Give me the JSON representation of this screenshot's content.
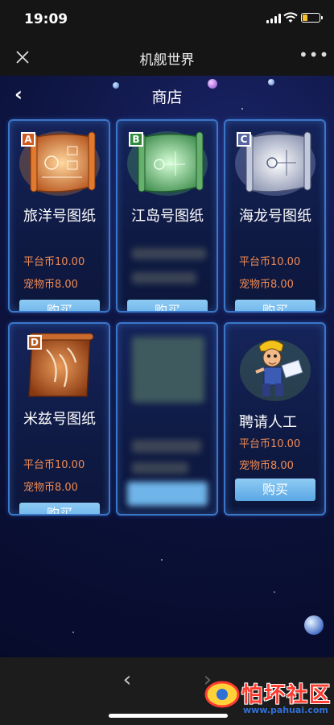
{
  "status": {
    "time": "19:09",
    "battery_percent": 30
  },
  "nav": {
    "title": "机舰世界",
    "close_icon": "close-icon",
    "more_label": "•••"
  },
  "page": {
    "title": "商店",
    "back_label": "‹"
  },
  "shop": {
    "currency_platform": "平台币",
    "currency_pet": "宠物币",
    "items": [
      {
        "letter": "A",
        "name": "旅洋号图纸",
        "price_platform": "平台币10.00",
        "price_pet": "宠物币8.00",
        "button": "购买",
        "icon": "blueprint-scroll-orange-icon"
      },
      {
        "letter": "B",
        "name": "江岛号图纸",
        "button": "购买",
        "icon": "blueprint-scroll-green-icon",
        "redacted": true
      },
      {
        "letter": "C",
        "name": "海龙号图纸",
        "price_platform": "平台币10.00",
        "price_pet": "宠物币8.00",
        "button": "购买",
        "icon": "blueprint-scroll-silver-icon"
      },
      {
        "letter": "D",
        "name": "米兹号图纸",
        "price_platform": "平台币10.00",
        "price_pet": "宠物币8.00",
        "button": "购买",
        "icon": "blueprint-scroll-bronze-icon"
      },
      {
        "name": "",
        "icon": "redacted-item-icon",
        "redacted": true
      },
      {
        "name": "聘请人工",
        "price_platform": "平台币10.00",
        "price_pet": "宠物币8.00",
        "button": "购买",
        "icon": "worker-character-icon"
      }
    ]
  },
  "bottom": {
    "prev_label": "‹",
    "next_label": "›"
  },
  "watermark": {
    "text": "怕坏社区",
    "url": "www.pahuai.com"
  },
  "colors": {
    "price": "#f08a52",
    "card_border": "#3a77c8",
    "button": "#6fb5ea",
    "background": "#0b1030"
  }
}
